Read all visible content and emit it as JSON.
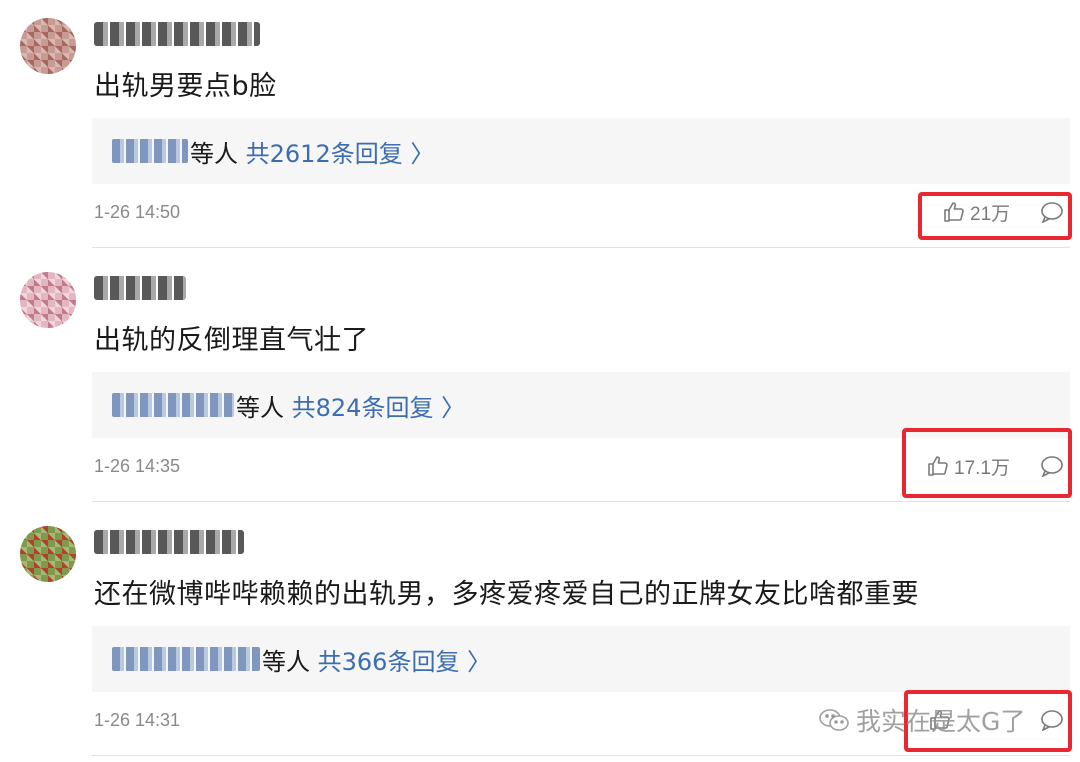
{
  "comments": [
    {
      "text": "出轨男要点b脸",
      "reply_etc": "等人",
      "reply_total": "共2612条回复",
      "reply_chevron": "〉",
      "time": "1-26 14:50",
      "likes": "21万",
      "like_icon": "thumbs-up-icon",
      "comment_icon": "speech-bubble-icon"
    },
    {
      "text": "出轨的反倒理直气壮了",
      "reply_etc": "等人",
      "reply_total": "共824条回复",
      "reply_chevron": "〉",
      "time": "1-26 14:35",
      "likes": "17.1万",
      "like_icon": "thumbs-up-icon",
      "comment_icon": "speech-bubble-icon"
    },
    {
      "text": "还在微博哔哔赖赖的出轨男，多疼爱疼爱自己的正牌女友比啥都重要",
      "reply_etc": "等人",
      "reply_total": "共366条回复",
      "reply_chevron": "〉",
      "time": "1-26 14:31",
      "likes": "",
      "like_icon": "thumbs-up-icon",
      "comment_icon": "speech-bubble-icon"
    }
  ],
  "watermark": {
    "text": "我实在是太G了",
    "icon": "wechat-icon"
  },
  "colors": {
    "link": "#3b6db0",
    "highlight": "#e8282e",
    "reply_bg": "#f6f6f6"
  }
}
